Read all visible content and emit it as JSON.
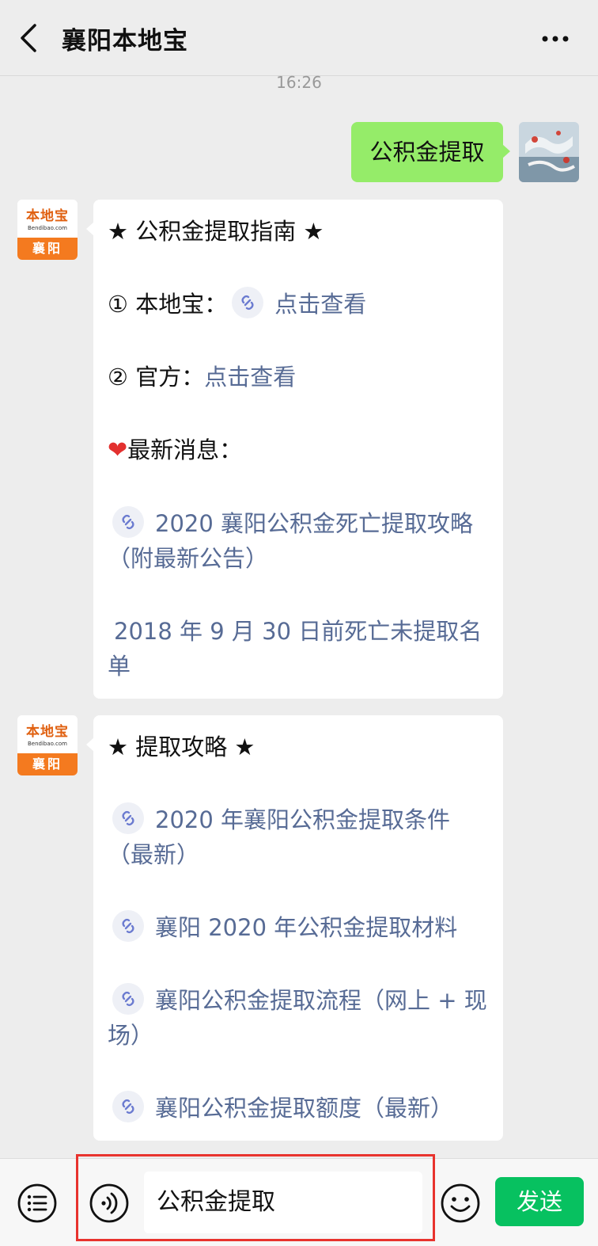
{
  "header": {
    "title": "襄阳本地宝",
    "back_icon": "back-chevron-icon",
    "more_icon": "more-dots-icon"
  },
  "chat": {
    "timestamp": "16:26",
    "outgoing": {
      "text": "公积金提取"
    },
    "oa_avatar": {
      "name": "本地宝",
      "url": "Bendibao.com",
      "city": "襄阳"
    },
    "message1": {
      "title": "★ 公积金提取指南 ★",
      "item1_prefix": "① 本地宝：",
      "item1_link": "点击查看",
      "item2_prefix": "② 官方：",
      "item2_link": "点击查看",
      "news_heading": "最新消息：",
      "news_link1": "2020 襄阳公积金死亡提取攻略（附最新公告）",
      "news_link2": "2018 年 9 月 30 日前死亡未提取名单"
    },
    "message2": {
      "title": "★ 提取攻略 ★",
      "links": [
        "2020 年襄阳公积金提取条件（最新）",
        "襄阳 2020 年公积金提取材料",
        "襄阳公积金提取流程（网上 + 现场）",
        "襄阳公积金提取额度（最新）"
      ]
    }
  },
  "input_bar": {
    "input_value": "公积金提取",
    "send_label": "发送",
    "icons": [
      "menu-list-icon",
      "voice-icon",
      "emoji-icon"
    ]
  },
  "colors": {
    "bubble_out": "#95ec69",
    "link": "#576b95",
    "send": "#07c160",
    "highlight": "#e8332e",
    "oa_orange": "#f47a1f"
  }
}
